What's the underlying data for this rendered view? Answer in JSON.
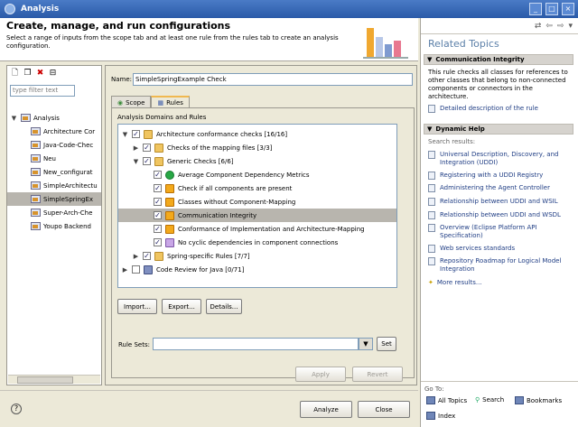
{
  "window": {
    "title": "Analysis"
  },
  "header": {
    "title": "Create, manage, and run configurations",
    "description": "Select a range of inputs from the scope tab and at least one rule from the rules tab to create an analysis configuration."
  },
  "left": {
    "filter_placeholder": "type filter text",
    "root_label": "Analysis",
    "items": [
      "Architecture Cor",
      "Java-Code-Chec",
      "Neu",
      "New_configurat",
      "SimpleArchitectu",
      "SimpleSpringEx",
      "Super-Arch-Che",
      "Youpo Backend"
    ],
    "selected_index": 5
  },
  "config": {
    "name_label": "Name:",
    "name_value": "SimpleSpringExample Check",
    "tabs": [
      "Scope",
      "Rules"
    ],
    "active_tab": "Rules",
    "domains_label": "Analysis Domains and Rules",
    "rules": [
      "Architecture conformance checks [16/16]",
      "Checks of the mapping files [3/3]",
      "Generic Checks [6/6]",
      "Average Component Dependency Metrics",
      "Check if all components are present",
      "Classes without Component-Mapping",
      "Communication Integrity",
      "Conformance of Implementation and Architecture-Mapping",
      "No cyclic dependencies in component connections",
      "Spring-specific Rules [7/7]",
      "Code Review for Java [0/71]"
    ],
    "import_label": "Import...",
    "export_label": "Export...",
    "details_label": "Details...",
    "rule_sets_label": "Rule Sets:",
    "set_label": "Set",
    "apply_label": "Apply",
    "revert_label": "Revert"
  },
  "footer": {
    "analyze_label": "Analyze",
    "close_label": "Close",
    "help_icon": "?"
  },
  "help": {
    "related_title": "Related Topics",
    "section1_title": "Communication Integrity",
    "section1_text": "This rule checks all classes for references to other classes that belong to non-connected components or connectors in the architecture.",
    "section1_link": "Detailed description of the rule",
    "section2_title": "Dynamic Help",
    "search_results_label": "Search results:",
    "links": [
      "Universal Description, Discovery, and Integration (UDDI)",
      "Registering with a UDDI Registry",
      "Administering the Agent Controller",
      "Relationship between UDDI and WSIL",
      "Relationship between UDDI and WSDL",
      "Overview (Eclipse Platform API Specification)",
      "Web services standards",
      "Repository Roadmap for Logical Model Integration"
    ],
    "more_results": "More results...",
    "goto_label": "Go To:",
    "all_topics": "All Topics",
    "search": "Search",
    "bookmarks": "Bookmarks",
    "index": "Index"
  }
}
